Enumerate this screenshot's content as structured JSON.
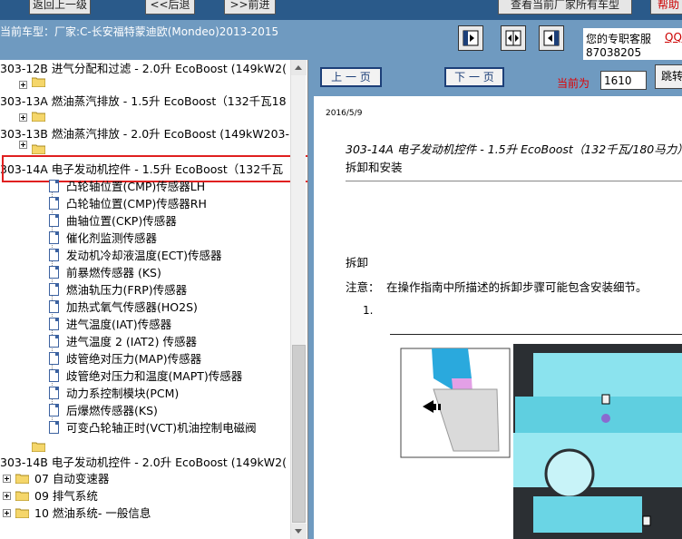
{
  "toolbar": {
    "back_home": "返回上一级",
    "back": "<<后退",
    "forward": ">>前进",
    "view_all": "查看当前厂家所有车型",
    "extra": "帮助"
  },
  "vehicle": {
    "label": "当前车型：厂家:C-长安福特蒙迪欧(Mondeo)2013-2015"
  },
  "service": {
    "label": "您的专职客服",
    "qq": "QQ:",
    "phone": "87038205"
  },
  "tree": {
    "items": [
      {
        "label": "303-12B 进气分配和过滤 - 2.0升 EcoBoost (149kW2("
      },
      {
        "label": "303-13A 燃油蒸汽排放 - 1.5升 EcoBoost（132千瓦18"
      },
      {
        "label": "303-13B 燃油蒸汽排放 - 2.0升 EcoBoost (149kW203-"
      },
      {
        "label": "303-14A 电子发动机控件 - 1.5升 EcoBoost（132千瓦"
      },
      {
        "label": "凸轮轴位置(CMP)传感器LH"
      },
      {
        "label": "凸轮轴位置(CMP)传感器RH"
      },
      {
        "label": "曲轴位置(CKP)传感器"
      },
      {
        "label": "催化剂监测传感器"
      },
      {
        "label": "发动机冷却液温度(ECT)传感器"
      },
      {
        "label": "前暴燃传感器 (KS)"
      },
      {
        "label": "燃油轨压力(FRP)传感器"
      },
      {
        "label": "加热式氧气传感器(HO2S)"
      },
      {
        "label": "进气温度(IAT)传感器"
      },
      {
        "label": "进气温度 2 (IAT2) 传感器"
      },
      {
        "label": "歧管绝对压力(MAP)传感器"
      },
      {
        "label": "歧管绝对压力和温度(MAPT)传感器"
      },
      {
        "label": "动力系控制模块(PCM)"
      },
      {
        "label": "后爆燃传感器(KS)"
      },
      {
        "label": "可变凸轮轴正时(VCT)机油控制电磁阀"
      },
      {
        "label": "303-14B 电子发动机控件 - 2.0升 EcoBoost (149kW2("
      },
      {
        "label": "07 自动变速器"
      },
      {
        "label": "09 排气系统"
      },
      {
        "label": "10 燃油系统- 一般信息"
      }
    ]
  },
  "nav": {
    "prev": "上 一 页",
    "next": "下 一 页",
    "current_label": "当前为",
    "page_value": "1610",
    "jump": "跳转"
  },
  "doc": {
    "date": "2016/5/9",
    "title": "303-14A 电子发动机控件 - 1.5升 EcoBoost（132千瓦/180马力）",
    "subtitle": "拆卸和安装",
    "section": "拆卸",
    "note_label": "注意：",
    "note_text": "在操作指南中所描述的拆卸步骤可能包含安装细节。",
    "step": "1."
  }
}
